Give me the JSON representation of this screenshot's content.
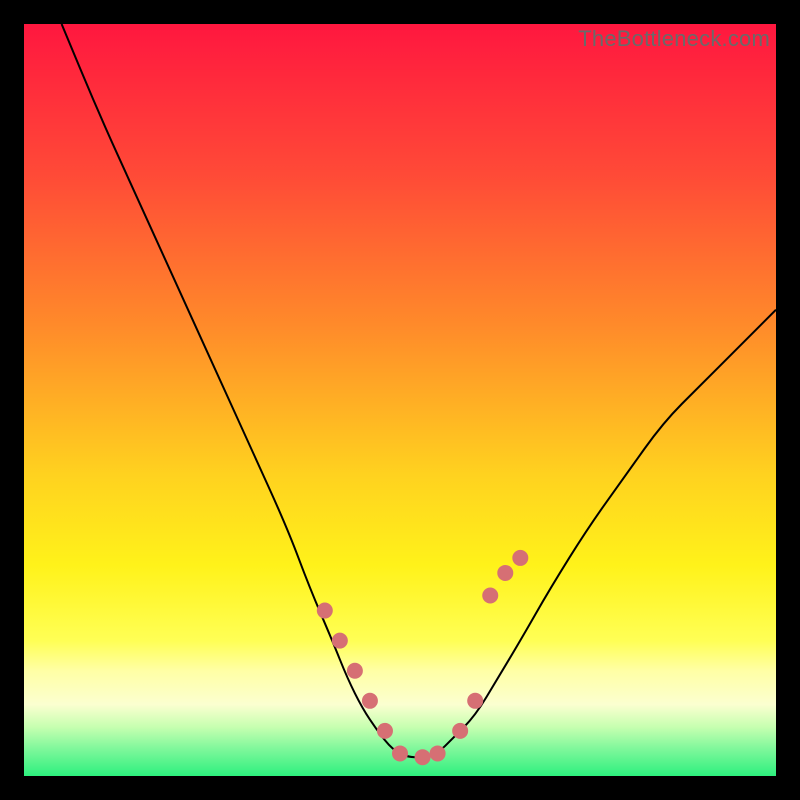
{
  "watermark": "TheBottleneck.com",
  "chart_data": {
    "type": "line",
    "title": "",
    "xlabel": "",
    "ylabel": "",
    "xlim": [
      0,
      100
    ],
    "ylim": [
      0,
      100
    ],
    "grid": false,
    "legend": false,
    "background_gradient_stops": [
      {
        "offset": 0.0,
        "color": "#ff173f"
      },
      {
        "offset": 0.2,
        "color": "#ff4a37"
      },
      {
        "offset": 0.4,
        "color": "#ff8a2a"
      },
      {
        "offset": 0.6,
        "color": "#ffd21f"
      },
      {
        "offset": 0.72,
        "color": "#fff21a"
      },
      {
        "offset": 0.82,
        "color": "#ffff55"
      },
      {
        "offset": 0.86,
        "color": "#ffffa5"
      },
      {
        "offset": 0.905,
        "color": "#fbffd0"
      },
      {
        "offset": 0.935,
        "color": "#c6ffb0"
      },
      {
        "offset": 0.965,
        "color": "#7cf79a"
      },
      {
        "offset": 1.0,
        "color": "#2df07e"
      }
    ],
    "series": [
      {
        "name": "curve",
        "stroke": "#000000",
        "stroke_width": 2,
        "x": [
          5,
          10,
          15,
          20,
          25,
          30,
          35,
          38,
          41,
          43,
          45,
          47,
          49,
          51,
          53,
          55,
          57,
          60,
          63,
          66,
          70,
          75,
          80,
          85,
          90,
          95,
          100
        ],
        "values": [
          100,
          88,
          77,
          66,
          55,
          44,
          33,
          25,
          18,
          13,
          9,
          6,
          3.5,
          2.5,
          2.5,
          3,
          5,
          8,
          13,
          18,
          25,
          33,
          40,
          47,
          52,
          57,
          62
        ]
      }
    ],
    "markers": {
      "name": "dots",
      "fill": "#d66f74",
      "radius": 8,
      "x": [
        40,
        42,
        44,
        46,
        48,
        50,
        53,
        55,
        58,
        60,
        62,
        64,
        66
      ],
      "values": [
        22,
        18,
        14,
        10,
        6,
        3,
        2.5,
        3,
        6,
        10,
        24,
        27,
        29
      ]
    }
  }
}
